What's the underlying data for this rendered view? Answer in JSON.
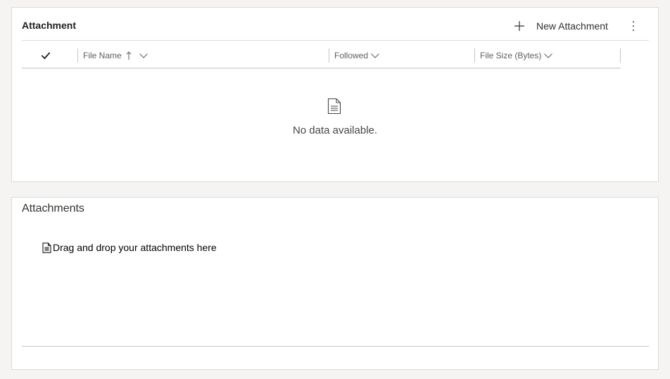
{
  "subgrid": {
    "title": "Attachment",
    "new_button_label": "New Attachment",
    "more_icon": "more-vertical-icon",
    "columns": [
      {
        "label": "File Name",
        "sort": "ascending",
        "icon": "sort-ascending-icon"
      },
      {
        "label": "Followed"
      },
      {
        "label": "File Size (Bytes)"
      }
    ],
    "empty_text": "No data available."
  },
  "attachments": {
    "title": "Attachments",
    "dropzone_label": "Drag and drop your attachments here"
  },
  "colors": {
    "background": "#f5f4f3",
    "card": "#ffffff",
    "border": "#dcdad8",
    "text": "#323130",
    "muted": "#605e5c"
  }
}
